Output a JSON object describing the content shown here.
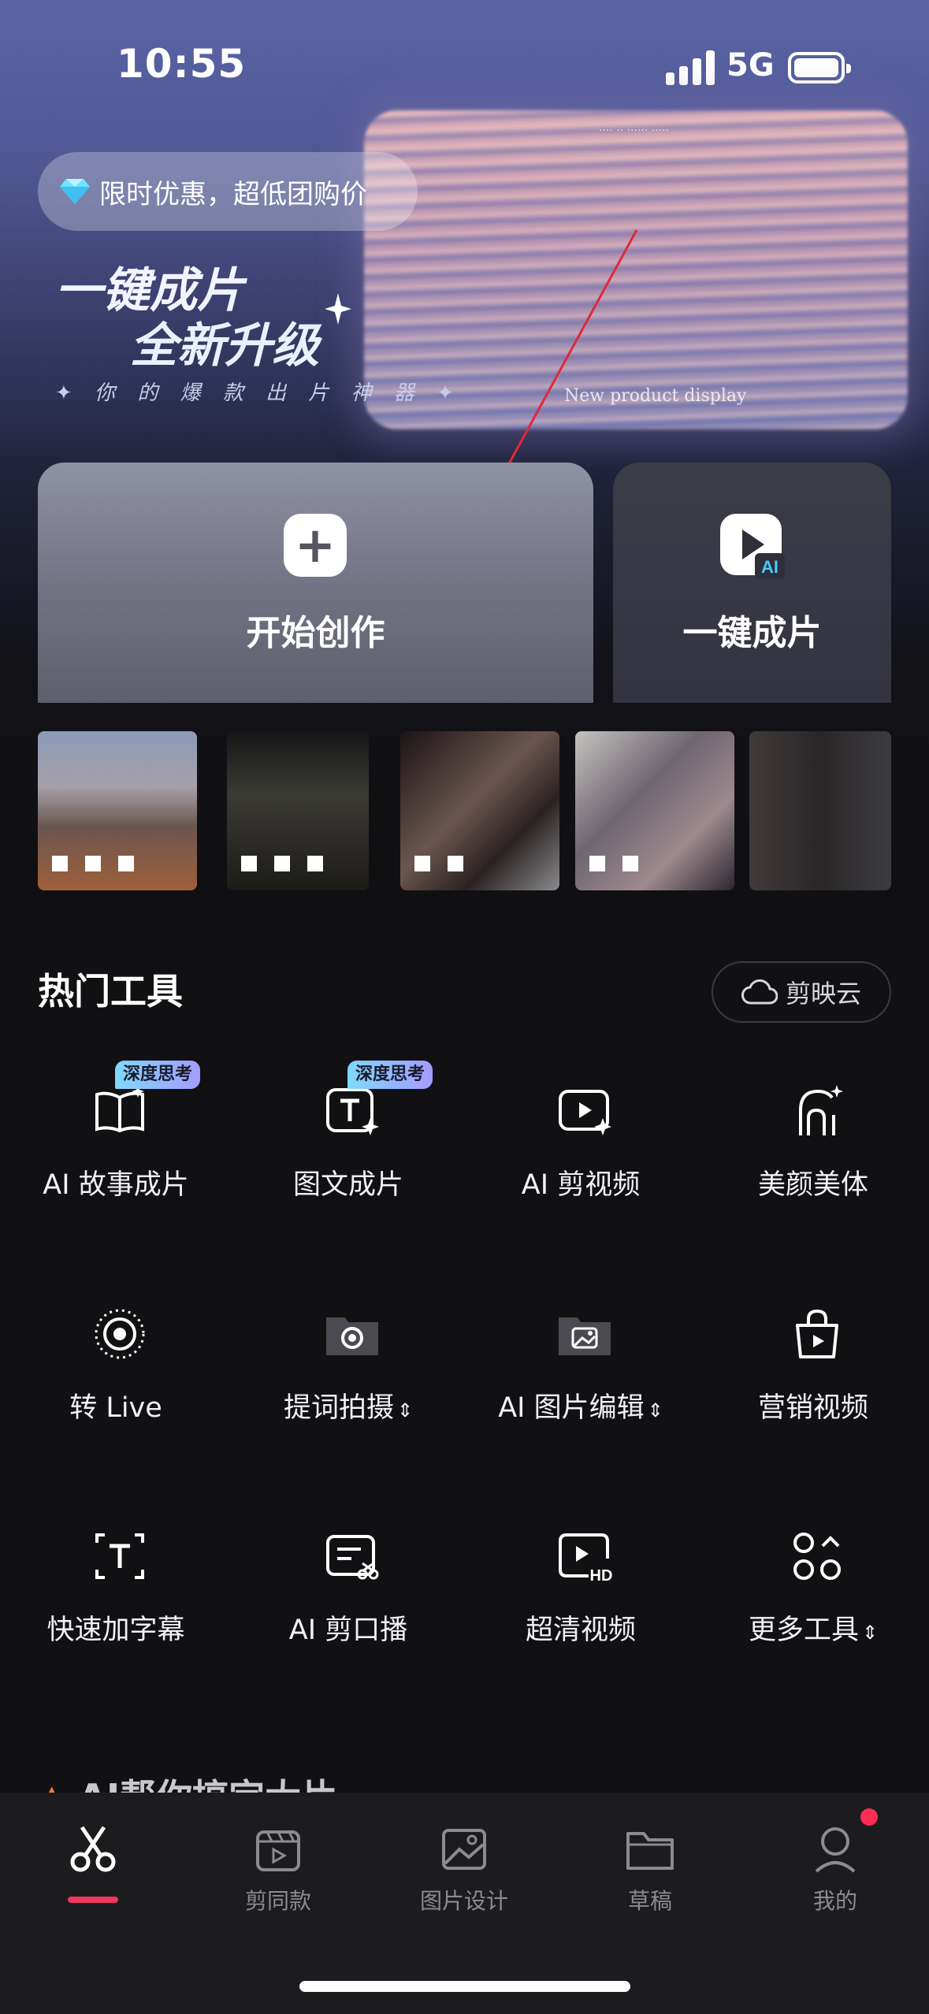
{
  "status_bar": {
    "time": "10:55",
    "network": "5G"
  },
  "promo": {
    "label": "限时优惠，超低团购价"
  },
  "banner": {
    "headline_1": "一键成片",
    "headline_2": "全新升级",
    "tagline": "✦ 你 的 爆 款 出 片 神 器 ✦",
    "image_caption": "New product display"
  },
  "actions": {
    "create_label": "开始创作",
    "oneclick_label": "一键成片"
  },
  "tools": {
    "title": "热门工具",
    "cloud_label": "剪映云",
    "badge": "深度思考",
    "items": [
      {
        "label": "AI 故事成片",
        "icon": "story-book-icon"
      },
      {
        "label": "图文成片",
        "icon": "text-to-video-icon"
      },
      {
        "label": "AI 剪视频",
        "icon": "ai-video-edit-icon"
      },
      {
        "label": "美颜美体",
        "icon": "beauty-icon"
      },
      {
        "label": "转 Live",
        "icon": "live-photo-icon"
      },
      {
        "label": "提词拍摄",
        "icon": "teleprompter-camera-icon"
      },
      {
        "label": "AI 图片编辑",
        "icon": "ai-image-edit-icon"
      },
      {
        "label": "营销视频",
        "icon": "marketing-bag-icon"
      },
      {
        "label": "快速加字幕",
        "icon": "subtitle-icon"
      },
      {
        "label": "AI 剪口播",
        "icon": "ai-talk-cut-icon"
      },
      {
        "label": "超清视频",
        "icon": "hd-video-icon"
      },
      {
        "label": "更多工具",
        "icon": "more-tools-icon"
      }
    ]
  },
  "section_peek": "AI帮你搞定大片",
  "tabbar": {
    "items": [
      {
        "label": "",
        "icon": "scissors-icon"
      },
      {
        "label": "剪同款",
        "icon": "template-icon"
      },
      {
        "label": "图片设计",
        "icon": "image-design-icon"
      },
      {
        "label": "草稿",
        "icon": "drafts-folder-icon"
      },
      {
        "label": "我的",
        "icon": "profile-icon"
      }
    ]
  },
  "colors": {
    "accent": "#f0365a",
    "badge_from": "#7fd8ff",
    "badge_to": "#a59bff",
    "notification": "#ff2d55"
  }
}
